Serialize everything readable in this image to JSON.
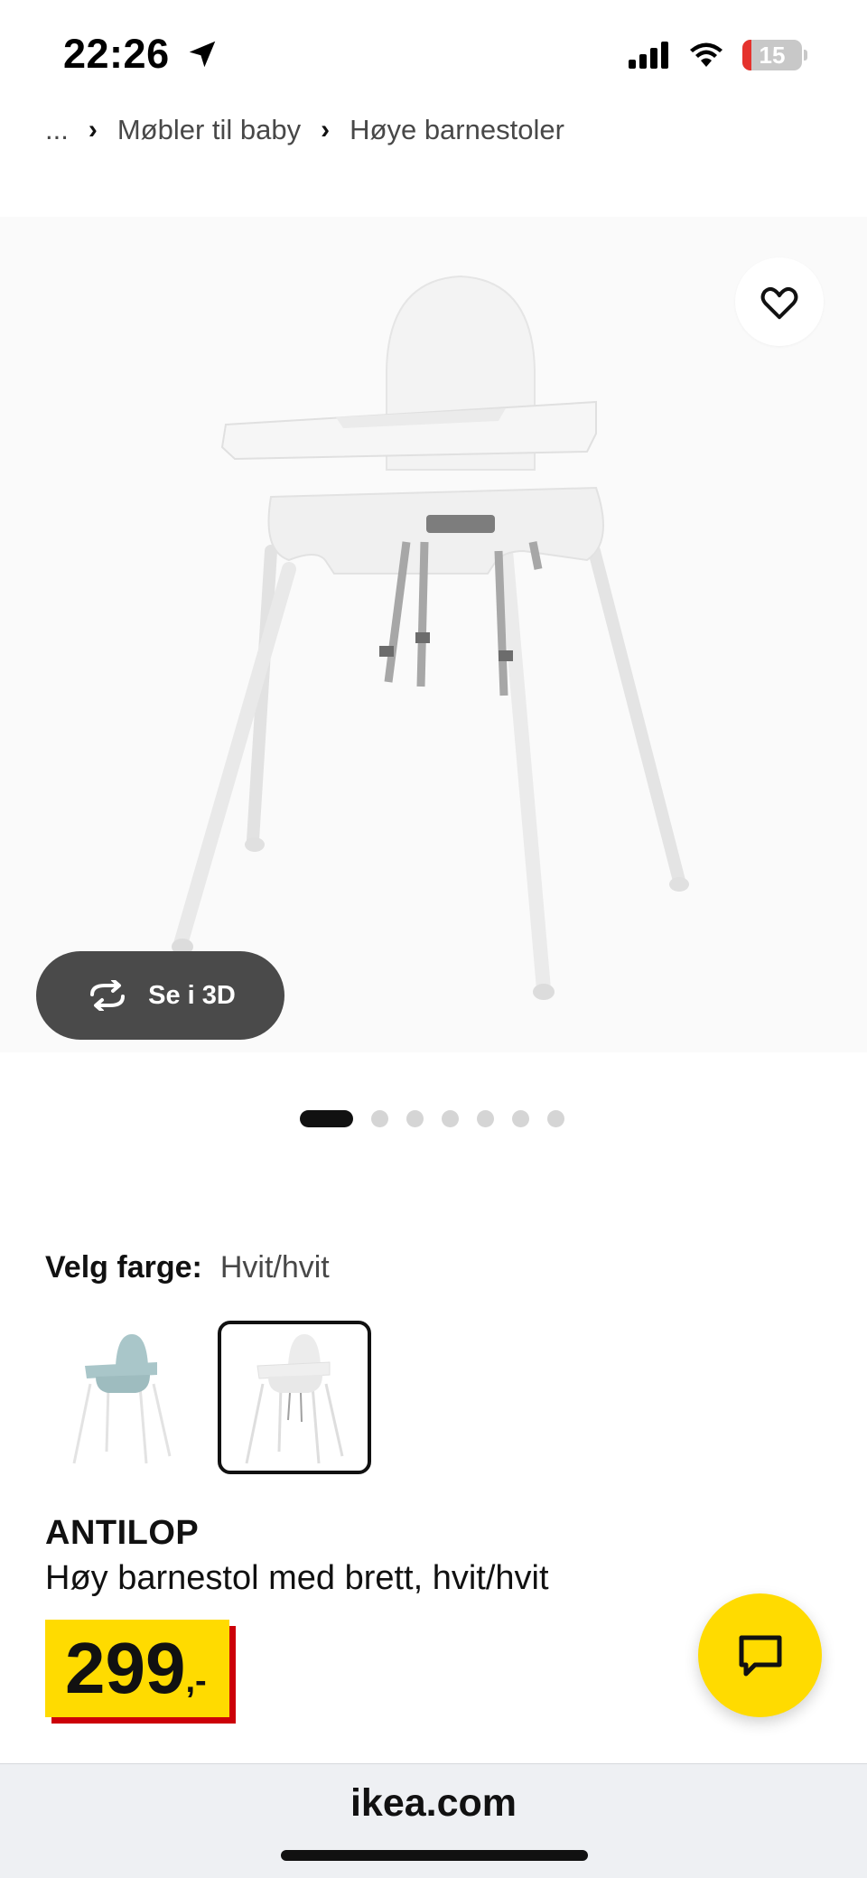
{
  "status_bar": {
    "time": "22:26",
    "battery_level": "15",
    "icons": [
      "location-arrow-icon",
      "cellular-signal-icon",
      "wifi-icon",
      "battery-icon"
    ]
  },
  "breadcrumb": {
    "items": [
      "...",
      "Møbler til baby",
      "Høye barnestoler"
    ],
    "separator_icon": "chevron-right-icon"
  },
  "gallery": {
    "favorite_icon": "heart-icon",
    "view_3d_label": "Se i 3D",
    "view_3d_icon": "rotate-icon",
    "image_count": 7,
    "active_index": 0
  },
  "color_picker": {
    "label": "Velg farge:",
    "selected_value": "Hvit/hvit",
    "options": [
      {
        "color": "#a9c6c9",
        "selected": false
      },
      {
        "color": "#ececec",
        "selected": true
      }
    ]
  },
  "product": {
    "name": "ANTILOP",
    "description": "Høy barnestol med brett, hvit/hvit",
    "price_integer": "299",
    "price_decimals": ",-"
  },
  "chat": {
    "icon": "chat-bubble-icon"
  },
  "browser": {
    "url": "ikea.com"
  },
  "colors": {
    "price_yellow": "#ffdb00",
    "price_shadow_red": "#cc0008",
    "button_dark": "#4a4a4a"
  }
}
